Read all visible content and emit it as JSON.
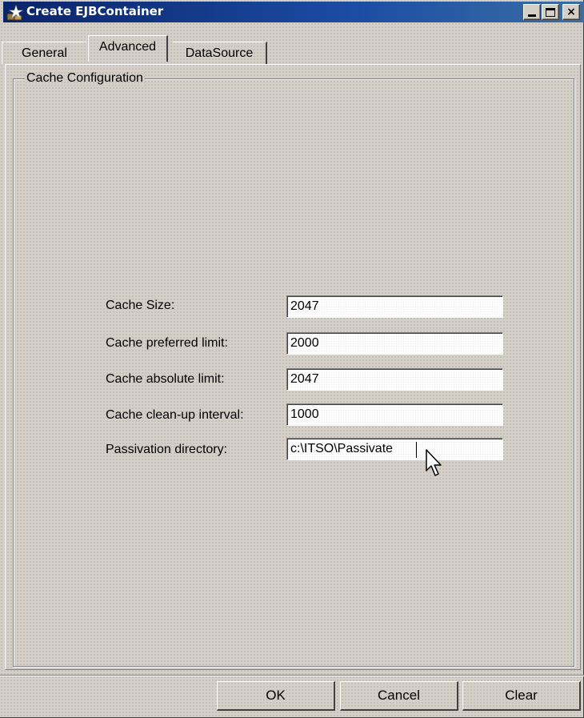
{
  "window": {
    "title": "Create EJBContainer",
    "icon": "ejb-container-app-icon",
    "controls": {
      "minimize": "minimize-icon",
      "maximize": "maximize-icon",
      "close": "×"
    }
  },
  "tabs": [
    {
      "label": "General",
      "active": false
    },
    {
      "label": "Advanced",
      "active": true
    },
    {
      "label": "DataSource",
      "active": false
    }
  ],
  "group": {
    "title": "Cache Configuration"
  },
  "fields": [
    {
      "label": "Cache Size:",
      "value": "2047"
    },
    {
      "label": "Cache preferred limit:",
      "value": "2000"
    },
    {
      "label": "Cache absolute limit:",
      "value": "2047"
    },
    {
      "label": "Cache clean-up interval:",
      "value": "1000"
    },
    {
      "label": "Passivation directory:",
      "value": "c:\\ITSO\\Passivate"
    }
  ],
  "buttons": {
    "ok": "OK",
    "cancel": "Cancel",
    "clear": "Clear"
  },
  "colors": {
    "titlebar": "#0a246a",
    "face": "#d4d0c8"
  }
}
